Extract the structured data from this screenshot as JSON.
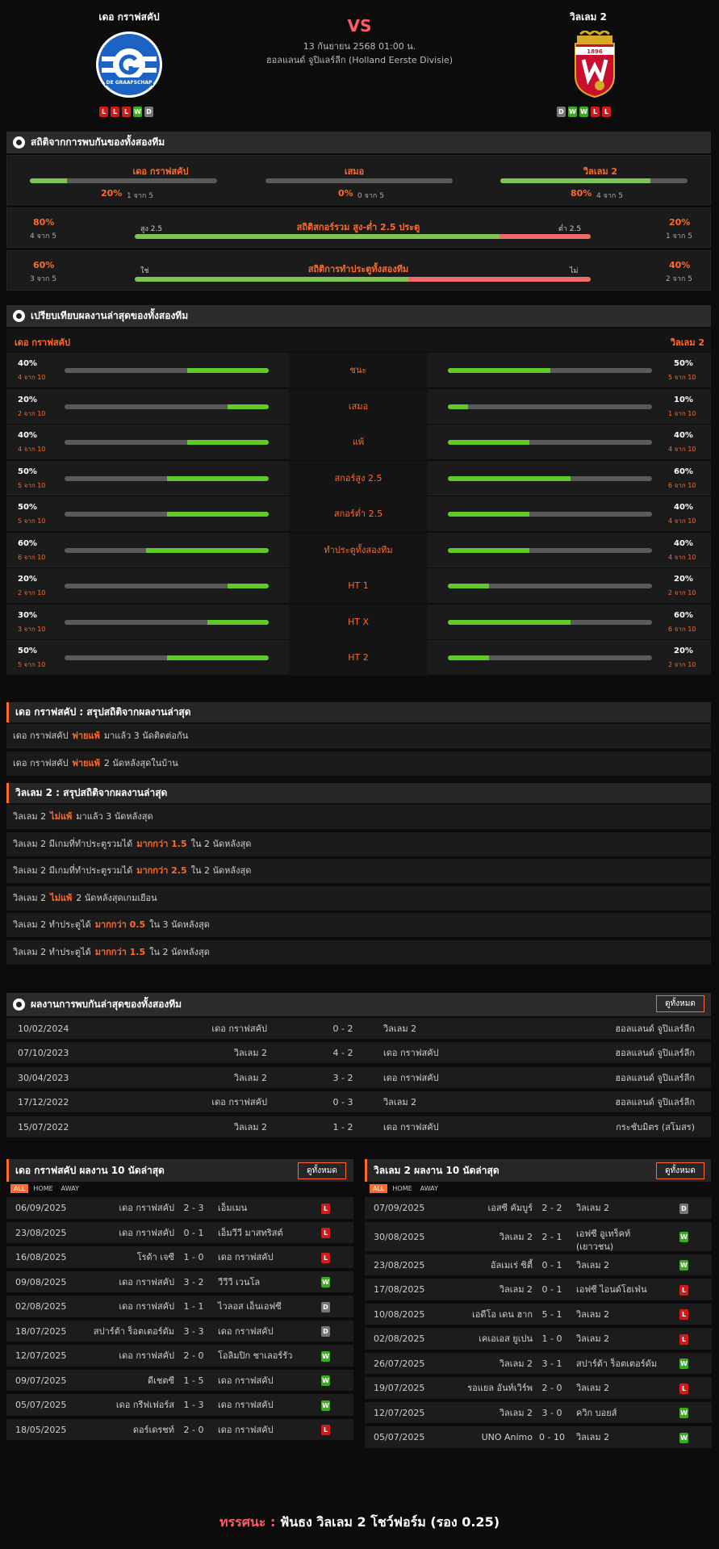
{
  "header": {
    "home_name": "เดอ กราฟสคัป",
    "away_name": "วิลเลม 2",
    "vs": "VS",
    "date": "13 กันยายน 2568 01:00 น.",
    "league": "ฮอลแลนด์ จูปิแลร์ลีก (Holland Eerste Divisie)",
    "home_logo_text": "DE GRAAFSCHAP",
    "away_logo_text": "1896",
    "home_form": [
      "L",
      "L",
      "L",
      "W",
      "D"
    ],
    "away_form": [
      "D",
      "W",
      "W",
      "L",
      "L"
    ]
  },
  "h2h_stats": {
    "title": "สถิติจากการพบกันของทั้งสองทีม",
    "home_label": "เดอ กราฟสคัป",
    "draw_label": "เสมอ",
    "away_label": "วิลเลม 2",
    "home_pct": "20%",
    "home_sub": "1 จาก 5",
    "home_fill": 0.2,
    "draw_pct": "0%",
    "draw_sub": "0 จาก 5",
    "draw_fill": 0,
    "away_pct": "80%",
    "away_sub": "4 จาก 5",
    "away_fill": 0.8,
    "ou": {
      "left_pct": "80%",
      "left_sub": "4 จาก 5",
      "over": "สูง 2.5",
      "title": "สถิติสกอร์รวม สูง-ต่ำ 2.5 ประตู",
      "under": "ต่ำ 2.5",
      "right_pct": "20%",
      "right_sub": "1 จาก 5",
      "fill": 0.8
    },
    "btts": {
      "left_pct": "60%",
      "left_sub": "3 จาก 5",
      "yes": "ใช่",
      "title": "สถิติการทำประตูทั้งสองทีม",
      "no": "ไม่",
      "right_pct": "40%",
      "right_sub": "2 จาก 5",
      "fill": 0.6
    }
  },
  "compare": {
    "title": "เปรียบเทียบผลงานล่าสุดของทั้งสองทีม",
    "home": "เดอ กราฟสคัป",
    "away": "วิลเลม 2",
    "rows": [
      {
        "label": "ชนะ",
        "hp": "40%",
        "hs": "4 จาก 10",
        "hf": 0.4,
        "ap": "50%",
        "as": "5 จาก 10",
        "af": 0.5
      },
      {
        "label": "เสมอ",
        "hp": "20%",
        "hs": "2 จาก 10",
        "hf": 0.2,
        "ap": "10%",
        "as": "1 จาก 10",
        "af": 0.1
      },
      {
        "label": "แพ้",
        "hp": "40%",
        "hs": "4 จาก 10",
        "hf": 0.4,
        "ap": "40%",
        "as": "4 จาก 10",
        "af": 0.4
      },
      {
        "label": "สกอร์สูง 2.5",
        "hp": "50%",
        "hs": "5 จาก 10",
        "hf": 0.5,
        "ap": "60%",
        "as": "6 จาก 10",
        "af": 0.6
      },
      {
        "label": "สกอร์ต่ำ 2.5",
        "hp": "50%",
        "hs": "5 จาก 10",
        "hf": 0.5,
        "ap": "40%",
        "as": "4 จาก 10",
        "af": 0.4
      },
      {
        "label": "ทำประตูทั้งสองทีม",
        "hp": "60%",
        "hs": "6 จาก 10",
        "hf": 0.6,
        "ap": "40%",
        "as": "4 จาก 10",
        "af": 0.4
      },
      {
        "label": "HT 1",
        "hp": "20%",
        "hs": "2 จาก 10",
        "hf": 0.2,
        "ap": "20%",
        "as": "2 จาก 10",
        "af": 0.2
      },
      {
        "label": "HT X",
        "hp": "30%",
        "hs": "3 จาก 10",
        "hf": 0.3,
        "ap": "60%",
        "as": "6 จาก 10",
        "af": 0.6
      },
      {
        "label": "HT 2",
        "hp": "50%",
        "hs": "5 จาก 10",
        "hf": 0.5,
        "ap": "20%",
        "as": "2 จาก 10",
        "af": 0.2
      }
    ]
  },
  "home_summary": {
    "title": "เดอ กราฟสคัป : สรุปสถิติจากผลงานล่าสุด",
    "rows": [
      {
        "pre": "เดอ กราฟสคัป",
        "hl": "พ่ายแพ้",
        "post": "มาแล้ว 3 นัดติดต่อกัน"
      },
      {
        "pre": "เดอ กราฟสคัป",
        "hl": "พ่ายแพ้",
        "post": "2  นัดหลังสุดในบ้าน"
      }
    ]
  },
  "away_summary": {
    "title": "วิลเลม 2 : สรุปสถิติจากผลงานล่าสุด",
    "rows": [
      {
        "pre": "วิลเลม 2",
        "hl": "ไม่แพ้",
        "post": "มาแล้ว 3 นัดหลังสุด"
      },
      {
        "pre": "วิลเลม 2  มีเกมที่ทำประตูรวมได้",
        "hl": "มากกว่า  1.5",
        "post": "ใน 2 นัดหลังสุด"
      },
      {
        "pre": "วิลเลม 2  มีเกมที่ทำประตูรวมได้",
        "hl": "มากกว่า  2.5",
        "post": "ใน 2 นัดหลังสุด"
      },
      {
        "pre": "วิลเลม 2",
        "hl": "ไม่แพ้",
        "post": "2  นัดหลังสุดเกมเยือน"
      },
      {
        "pre": "วิลเลม 2  ทำประตูได้",
        "hl": "มากกว่า  0.5",
        "post": "ใน 3 นัดหลังสุด"
      },
      {
        "pre": "วิลเลม 2  ทำประตูได้",
        "hl": "มากกว่า  1.5",
        "post": "ใน 2 นัดหลังสุด"
      }
    ]
  },
  "h2h": {
    "title": "ผลงานการพบกันล่าสุดของทั้งสองทีม",
    "view_all": "ดูทั้งหมด",
    "rows": [
      {
        "date": "10/02/2024",
        "home": "เดอ กราฟสคัป",
        "score": "0 - 2",
        "away": "วิลเลม 2",
        "league": "ฮอลแลนด์ จูปิแลร์ลีก"
      },
      {
        "date": "07/10/2023",
        "home": "วิลเลม 2",
        "score": "4 - 2",
        "away": "เดอ กราฟสคัป",
        "league": "ฮอลแลนด์ จูปิแลร์ลีก"
      },
      {
        "date": "30/04/2023",
        "home": "วิลเลม 2",
        "score": "3 - 2",
        "away": "เดอ กราฟสคัป",
        "league": "ฮอลแลนด์ จูปิแลร์ลีก"
      },
      {
        "date": "17/12/2022",
        "home": "เดอ กราฟสคัป",
        "score": "0 - 3",
        "away": "วิลเลม 2",
        "league": "ฮอลแลนด์ จูปิแลร์ลีก"
      },
      {
        "date": "15/07/2022",
        "home": "วิลเลม 2",
        "score": "1 - 2",
        "away": "เดอ กราฟสคัป",
        "league": "กระชับมิตร (สโมสร)"
      }
    ]
  },
  "home_last10": {
    "title": "เดอ กราฟสคัป ผลงาน 10 นัดล่าสุด",
    "view_all": "ดูทั้งหมด",
    "tabs": [
      "ALL",
      "HOME",
      "AWAY"
    ],
    "rows": [
      {
        "date": "06/09/2025",
        "home": "เดอ กราฟสคัป",
        "score": "2 - 3",
        "away": "เอ็มเมน",
        "res": "L"
      },
      {
        "date": "23/08/2025",
        "home": "เดอ กราฟสคัป",
        "score": "0 - 1",
        "away": "เอ็มวีวี มาสทริสต์",
        "res": "L"
      },
      {
        "date": "16/08/2025",
        "home": "โรด้า เจซี",
        "score": "1 - 0",
        "away": "เดอ กราฟสคัป",
        "res": "L"
      },
      {
        "date": "09/08/2025",
        "home": "เดอ กราฟสคัป",
        "score": "3 - 2",
        "away": "วีวีวี เวนโล",
        "res": "W"
      },
      {
        "date": "02/08/2025",
        "home": "เดอ กราฟสคัป",
        "score": "1 - 1",
        "away": "ไวลอส เอ็นเอฟซี",
        "res": "D"
      },
      {
        "date": "18/07/2025",
        "home": "สปาร์ต้า ร็อตเตอร์ดัม",
        "score": "3 - 3",
        "away": "เดอ กราฟสคัป",
        "res": "D"
      },
      {
        "date": "12/07/2025",
        "home": "เดอ กราฟสคัป",
        "score": "2 - 0",
        "away": "โอลิมปิก ชาเลอร์รัว",
        "res": "W"
      },
      {
        "date": "09/07/2025",
        "home": "ดีเชตซี",
        "score": "1 - 5",
        "away": "เดอ กราฟสคัป",
        "res": "W"
      },
      {
        "date": "05/07/2025",
        "home": "เดอ กรีฟเฟอร์ส",
        "score": "1 - 3",
        "away": "เดอ กราฟสคัป",
        "res": "W"
      },
      {
        "date": "18/05/2025",
        "home": "ดอร์เดรชท์",
        "score": "2 - 0",
        "away": "เดอ กราฟสคัป",
        "res": "L"
      }
    ]
  },
  "away_last10": {
    "title": "วิลเลม 2 ผลงาน 10 นัดล่าสุด",
    "view_all": "ดูทั้งหมด",
    "tabs": [
      "ALL",
      "HOME",
      "AWAY"
    ],
    "rows": [
      {
        "date": "07/09/2025",
        "home": "เอสซี คัมบูร์",
        "score": "2 - 2",
        "away": "วิลเลม 2",
        "res": "D"
      },
      {
        "date": "30/08/2025",
        "home": "วิลเลม 2",
        "score": "2 - 1",
        "away": "เอฟซี อูเทร็คท์ (เยาวชน)",
        "res": "W"
      },
      {
        "date": "23/08/2025",
        "home": "อัลเมเร่ ซิตี้",
        "score": "0 - 1",
        "away": "วิลเลม 2",
        "res": "W"
      },
      {
        "date": "17/08/2025",
        "home": "วิลเลม 2",
        "score": "0 - 1",
        "away": "เอฟซี ไอนด์โฮเฟ่น",
        "res": "L"
      },
      {
        "date": "10/08/2025",
        "home": "เอดีโอ เดน ฮาก",
        "score": "5 - 1",
        "away": "วิลเลม 2",
        "res": "L"
      },
      {
        "date": "02/08/2025",
        "home": "เคเอเอส ยูเปน",
        "score": "1 - 0",
        "away": "วิลเลม 2",
        "res": "L"
      },
      {
        "date": "26/07/2025",
        "home": "วิลเลม 2",
        "score": "3 - 1",
        "away": "สปาร์ต้า ร็อตเตอร์ดัม",
        "res": "W"
      },
      {
        "date": "19/07/2025",
        "home": "รอแยล อันท์เวิร์พ",
        "score": "2 - 0",
        "away": "วิลเลม 2",
        "res": "L"
      },
      {
        "date": "12/07/2025",
        "home": "วิลเลม 2",
        "score": "3 - 0",
        "away": "ควิก บอยส์",
        "res": "W"
      },
      {
        "date": "05/07/2025",
        "home": "UNO Animo",
        "score": "0 - 10",
        "away": "วิลเลม 2",
        "res": "W"
      }
    ]
  },
  "prediction": {
    "label": "ทรรศนะ :",
    "text": "ฟันธง วิลเลม 2 โชว์ฟอร์ม (รอง 0.25)"
  },
  "colors": {
    "accent": "#ff6a2a",
    "win": "#3cab1e",
    "loss": "#d11a1a",
    "draw": "#777777",
    "bar_green": "#5ec927",
    "bar_red": "#f06a6a"
  }
}
